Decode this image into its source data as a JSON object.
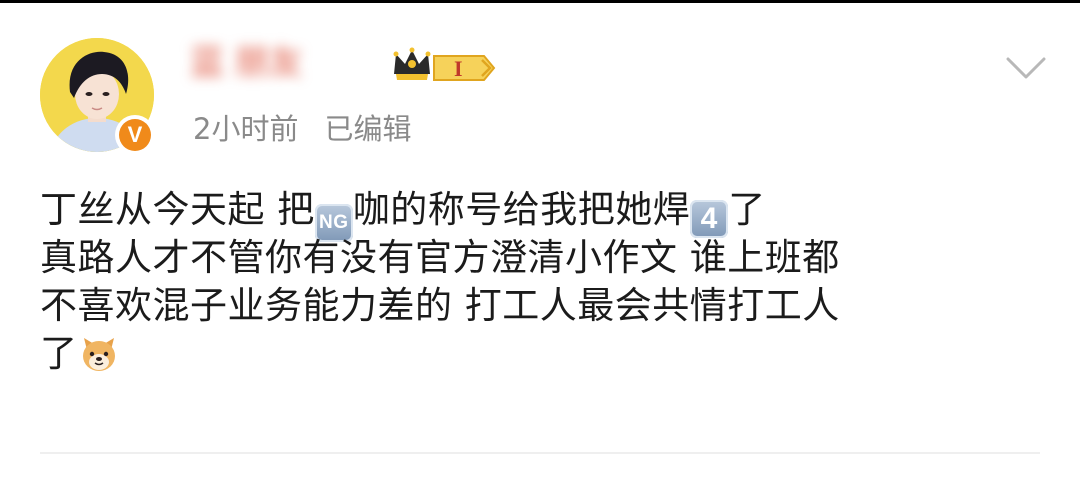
{
  "post": {
    "author": {
      "name": "蓝 朋友",
      "verified_badge": "V",
      "level_badge": "I"
    },
    "timestamp": "2小时前",
    "edited": "已编辑",
    "content": {
      "line1_a": "丁丝从今天起 把",
      "emoji_ng": "NG",
      "line1_b": "咖的称号给我把她焊",
      "emoji_4": "4",
      "line1_c": "了",
      "line2": "真路人才不管你有没有官方澄清小作文 谁上班都",
      "line3": "不喜欢混子业务能力差的 打工人最会共情打工人",
      "line4": "了"
    },
    "icons": {
      "crown": "crown-icon",
      "menu": "chevron-down-icon",
      "dog": "dog-emoji-icon"
    }
  },
  "colors": {
    "name": "#e0604b",
    "meta": "#8a8a8a",
    "verified": "#f08a1a",
    "level_gold": "#f3c12f"
  }
}
